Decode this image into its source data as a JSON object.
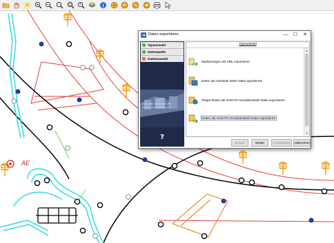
{
  "toolbar": {
    "tools": [
      {
        "icon": "open-folder-icon"
      },
      {
        "icon": "pan-hand-icon"
      },
      {
        "icon": "sun-icon"
      },
      {
        "icon": "zoom-in-icon"
      },
      {
        "icon": "zoom-out-icon"
      },
      {
        "icon": "zoom-window-icon"
      },
      {
        "icon": "zoom-all-icon"
      },
      {
        "icon": "zoom-previous-icon"
      },
      {
        "icon": "layer-icon"
      },
      {
        "icon": "info-icon"
      },
      {
        "icon": "globe-icon"
      },
      {
        "icon": "route-icon"
      },
      {
        "icon": "measure-icon"
      },
      {
        "icon": "select-icon"
      },
      {
        "icon": "print-icon"
      },
      {
        "icon": "pointer-icon"
      }
    ]
  },
  "map": {
    "annotation": "AE",
    "colors": {
      "cable": "#000000",
      "boundary": "#e03c3c",
      "pipe": "#30d8e0",
      "lamp": "#f2a11c",
      "hatch": "#e88a2c"
    }
  },
  "dialog": {
    "title": "Daten exportieren",
    "window_controls": {
      "minimize": "—",
      "maximize": "☐",
      "close": "✕"
    },
    "steps": [
      {
        "label": "Typauswahl",
        "status": "done",
        "color": "#2fa12f"
      },
      {
        "label": "Datenquelle",
        "status": "done",
        "color": "#2fa12f"
      },
      {
        "label": "Dateiauswahl",
        "status": "pending",
        "color": "#d23030"
      }
    ],
    "caption": "Wahl der Datenart, die exportiert werden soll",
    "help": "?",
    "panel_header": "Typauswahl",
    "options": [
      {
        "label": "Markierungen als XML exportieren",
        "icon": "xml-export-icon",
        "selected": false
      },
      {
        "label": "Daten als Autodesk DWG Datei exportieren",
        "icon": "dwg-export-icon",
        "selected": false
      },
      {
        "label": "Shape-Daten als mnDATA Geodatenbank Datei exportieren",
        "icon": "shape-export-icon",
        "selected": false
      },
      {
        "label": "Daten als mnDATA Geodatenbank Datei exportieren",
        "icon": "geodb-export-icon",
        "selected": true
      }
    ],
    "buttons": {
      "back": "Zurück",
      "next": "Weiter",
      "finish": "Fertigstellen",
      "cancel": "Abbrechen"
    }
  }
}
